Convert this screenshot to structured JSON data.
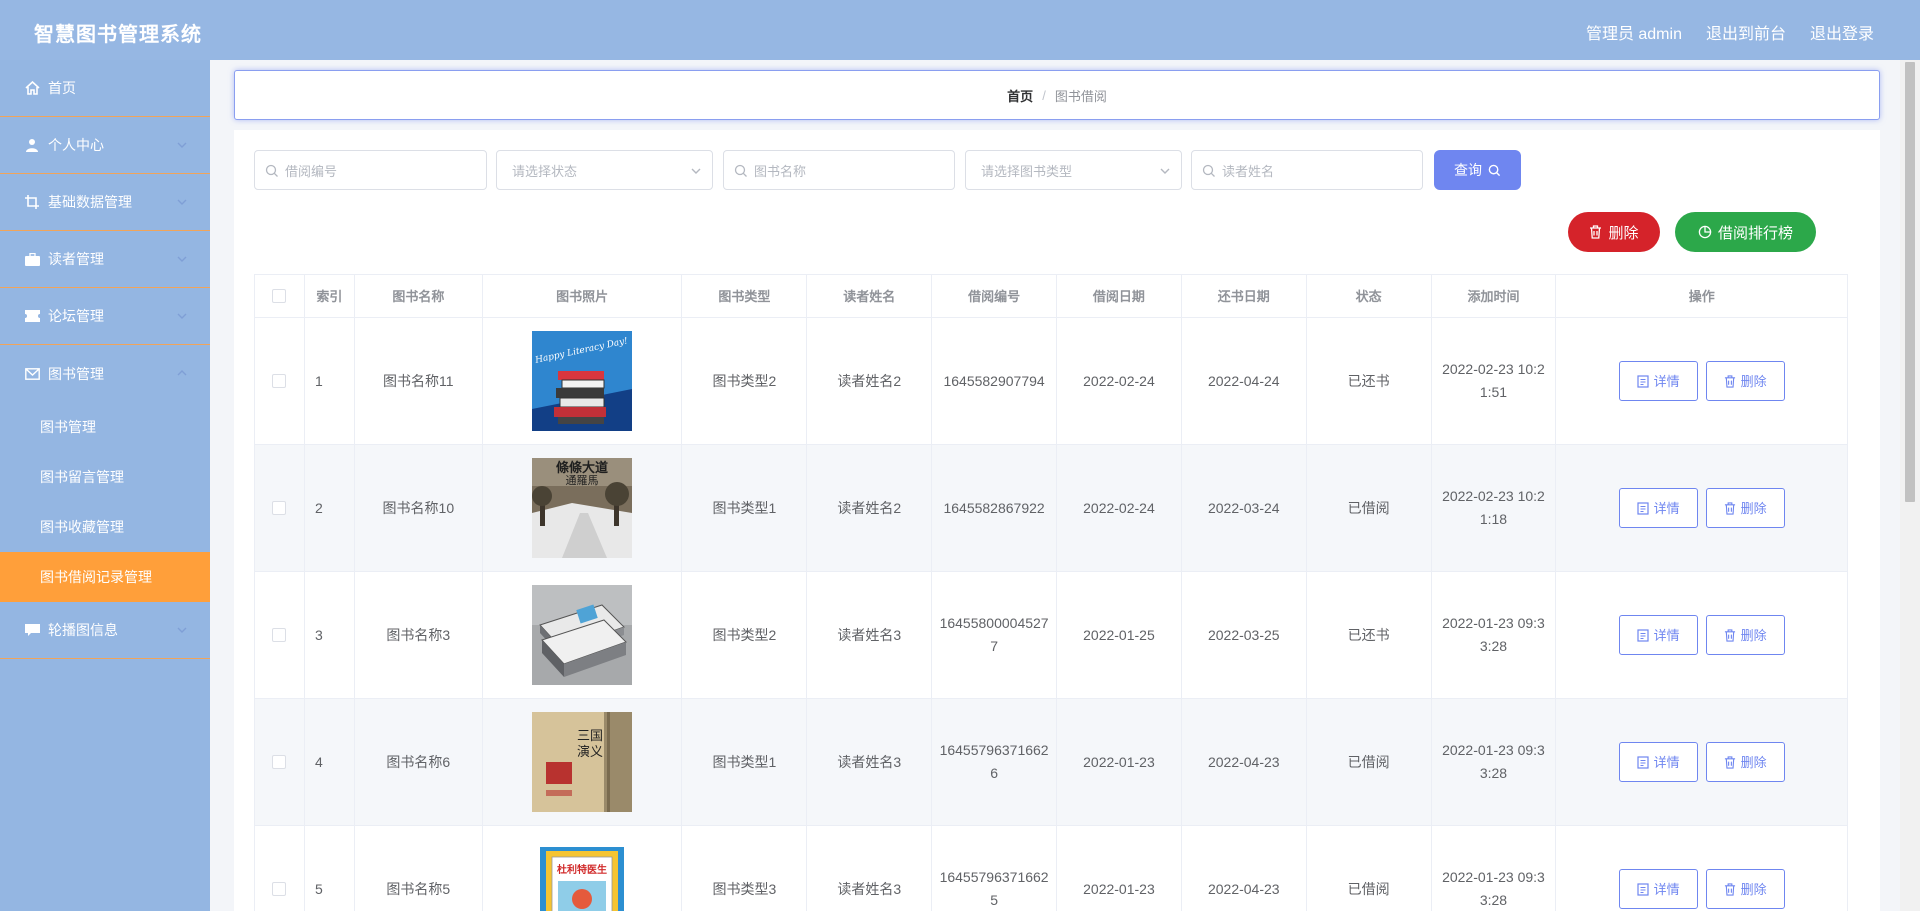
{
  "header": {
    "title": "智慧图书管理系统",
    "nav": [
      "管理员 admin",
      "退出到前台",
      "退出登录"
    ]
  },
  "sidebar": {
    "items": [
      {
        "label": "首页",
        "icon": "home-icon"
      },
      {
        "label": "个人中心",
        "icon": "user-icon"
      },
      {
        "label": "基础数据管理",
        "icon": "crop-icon"
      },
      {
        "label": "读者管理",
        "icon": "briefcase-icon"
      },
      {
        "label": "论坛管理",
        "icon": "tickets-icon"
      },
      {
        "label": "图书管理",
        "icon": "mail-icon"
      }
    ],
    "sub_items": [
      "图书管理",
      "图书留言管理",
      "图书收藏管理",
      "图书借阅记录管理"
    ],
    "last_item": {
      "label": "轮播图信息",
      "icon": "chat-icon"
    },
    "active_sub_index": 3
  },
  "breadcrumb": {
    "home": "首页",
    "current": "图书借阅"
  },
  "filters": {
    "borrow_no_placeholder": "借阅编号",
    "status_placeholder": "请选择状态",
    "book_name_placeholder": "图书名称",
    "book_type_placeholder": "请选择图书类型",
    "reader_name_placeholder": "读者姓名",
    "query_label": "查询"
  },
  "actions": {
    "delete_label": "删除",
    "rank_label": "借阅排行榜"
  },
  "table": {
    "headers": [
      "索引",
      "图书名称",
      "图书照片",
      "图书类型",
      "读者姓名",
      "借阅编号",
      "借阅日期",
      "还书日期",
      "状态",
      "添加时间",
      "操作"
    ],
    "detail_label": "详情",
    "delete_label": "删除",
    "rows": [
      {
        "index": "1",
        "name": "图书名称11",
        "type": "图书类型2",
        "reader": "读者姓名2",
        "borrow_no": "1645582907794",
        "borrow_date": "2022-02-24",
        "return_date": "2022-04-24",
        "status": "已还书",
        "added": "2022-02-23 10:21:51",
        "photo": "book-stack-blue"
      },
      {
        "index": "2",
        "name": "图书名称10",
        "type": "图书类型1",
        "reader": "读者姓名2",
        "borrow_no": "1645582867922",
        "borrow_date": "2022-02-24",
        "return_date": "2022-03-24",
        "status": "已借阅",
        "added": "2022-02-23 10:21:18",
        "photo": "book-cover-snow-road"
      },
      {
        "index": "3",
        "name": "图书名称3",
        "type": "图书类型2",
        "reader": "读者姓名3",
        "borrow_no": "164558000045277",
        "borrow_date": "2022-01-25",
        "return_date": "2022-03-25",
        "status": "已还书",
        "added": "2022-01-23 09:33:28",
        "photo": "book-pile-grey"
      },
      {
        "index": "4",
        "name": "图书名称6",
        "type": "图书类型1",
        "reader": "读者姓名3",
        "borrow_no": "164557963716626",
        "borrow_date": "2022-01-23",
        "return_date": "2022-04-23",
        "status": "已借阅",
        "added": "2022-01-23 09:33:28",
        "photo": "book-cover-sanguo"
      },
      {
        "index": "5",
        "name": "图书名称5",
        "type": "图书类型3",
        "reader": "读者姓名3",
        "borrow_no": "164557963716625",
        "borrow_date": "2022-01-23",
        "return_date": "2022-04-23",
        "status": "已借阅",
        "added": "2022-01-23 09:33:28",
        "photo": "book-cover-kids"
      }
    ]
  },
  "colors": {
    "header_bg": "#96b7e3",
    "sidebar_bg": "#94b6e2",
    "active_menu": "#ff9f3a",
    "primary": "#6f86f0",
    "danger": "#d5232a",
    "success": "#2ca84a"
  }
}
